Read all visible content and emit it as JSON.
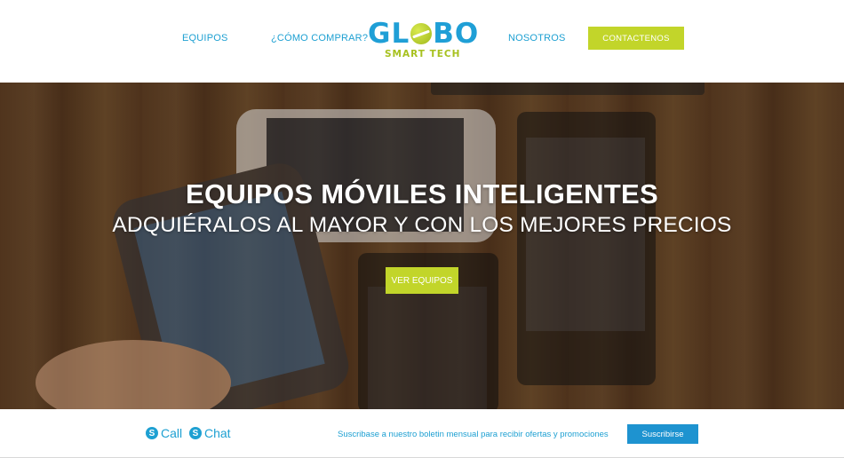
{
  "nav": {
    "links": [
      "EQUIPOS",
      "¿CÓMO COMPRAR?",
      "NOSOTROS"
    ],
    "contact_label": "CONTACTENOS",
    "logo_text_left": "GL",
    "logo_text_right": "BO",
    "logo_subtitle": "SMART TECH"
  },
  "hero": {
    "title": "EQUIPOS MÓVILES INTELIGENTES",
    "subtitle": "ADQUIÉRALOS AL MAYOR Y CON LOS MEJORES PRECIOS",
    "button_label": "VER EQUIPOS"
  },
  "footer": {
    "call_label": "Call",
    "chat_label": "Chat",
    "newsletter_text": "Suscribase a nuestro boletin mensual para recibir ofertas y promociones",
    "subscribe_label": "Suscribirse"
  },
  "colors": {
    "accent_green": "#c2d52a",
    "brand_blue": "#1ea0d2",
    "button_blue": "#1e93d0"
  }
}
